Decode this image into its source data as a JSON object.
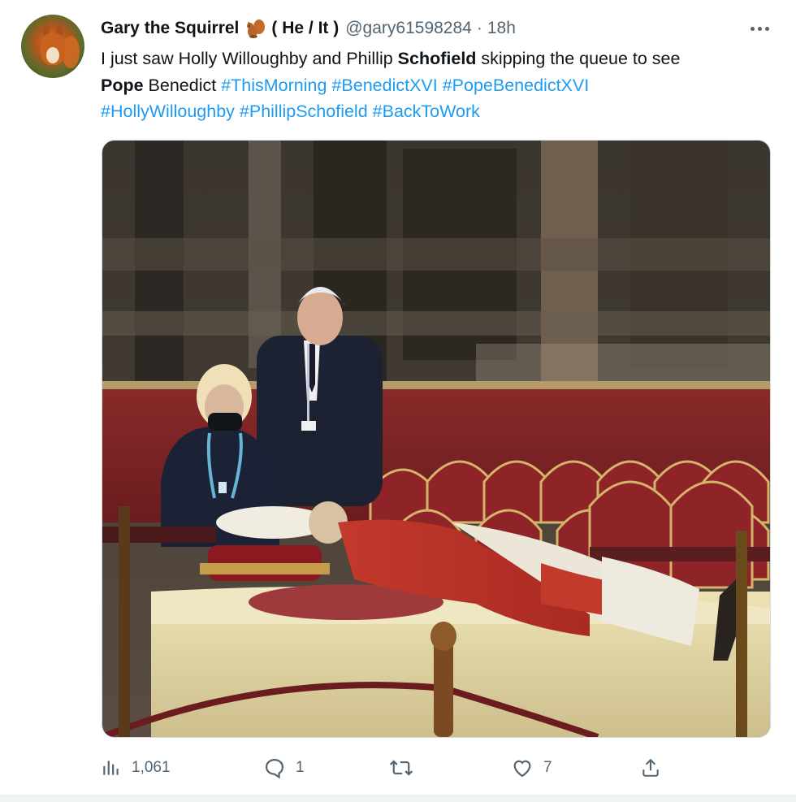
{
  "tweet": {
    "display_name": "Gary the Squirrel",
    "emoji": "squirrel-emoji",
    "pronouns": "( He / It )",
    "handle": "@gary61598284",
    "separator": "·",
    "time": "18h",
    "more_icon": "more-horizontal-icon",
    "text": {
      "p1": "I just saw Holly Willoughby and Phillip ",
      "b1": "Schofield",
      "p2": " skipping the queue to see ",
      "b2": "Pope",
      "p3": " Benedict ",
      "h1": "#ThisMorning",
      "h2": "#BenedictXVI",
      "h3": "#PopeBenedictXVI",
      "h4": "#HollyWilloughby",
      "h5": "#PhillipSchofield",
      "h6": "#BackToWork"
    },
    "media": {
      "type": "photo",
      "description_icon": "photo"
    },
    "actions": {
      "views": {
        "icon": "analytics-icon",
        "count": "1,061"
      },
      "replies": {
        "icon": "reply-icon",
        "count": "1"
      },
      "retweets": {
        "icon": "retweet-icon",
        "count": ""
      },
      "likes": {
        "icon": "like-icon",
        "count": "7"
      },
      "share": {
        "icon": "share-icon"
      }
    }
  },
  "colors": {
    "text": "#0f1419",
    "secondary": "#536471",
    "link": "#1d9bf0",
    "border": "#cfd9de"
  }
}
